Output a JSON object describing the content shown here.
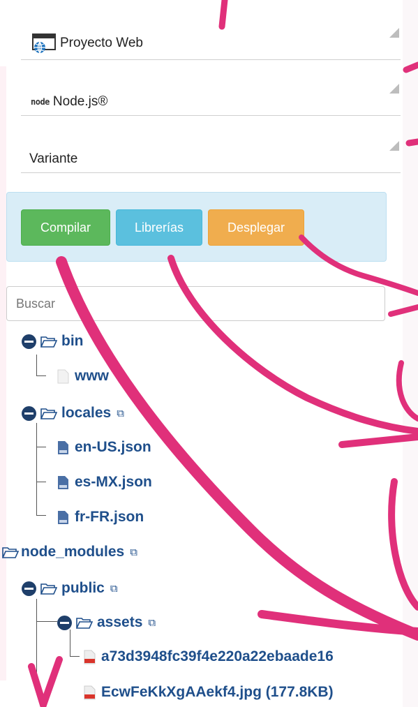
{
  "selects": {
    "project": {
      "label": "Proyecto Web",
      "icon": "globe-window-icon"
    },
    "runtime": {
      "label": "Node.js®",
      "icon_text": "node",
      "icon": "nodejs-logo-icon"
    },
    "variant": {
      "label": "Variante"
    }
  },
  "actions": {
    "compile": "Compilar",
    "libraries": "Librerías",
    "deploy": "Desplegar"
  },
  "search": {
    "placeholder": "Buscar"
  },
  "tree": {
    "bin": "bin",
    "www": "www",
    "locales": "locales",
    "en": "en-US.json",
    "es": "es-MX.json",
    "fr": "fr-FR.json",
    "node_modules": "node_modules",
    "public": "public",
    "assets": "assets",
    "file1": "a73d3948fc39f4e220a22ebaade16",
    "file2": "EcwFeKkXgAAekf4.jpg (177.8KB)",
    "copy_glyph": "⧉"
  },
  "colors": {
    "annotation": "#e0307a",
    "tree_text": "#1f4f8b",
    "actions_bg": "#d9edf7"
  }
}
